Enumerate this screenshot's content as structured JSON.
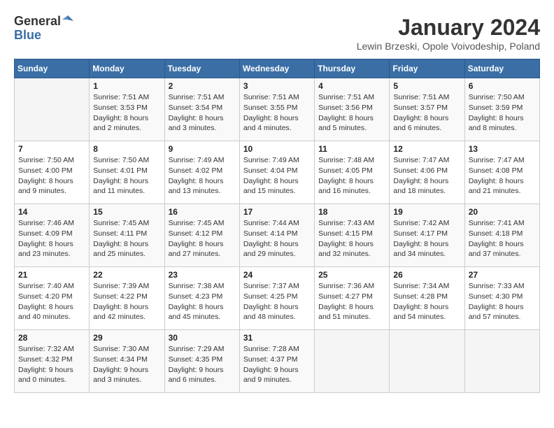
{
  "logo": {
    "general": "General",
    "blue": "Blue"
  },
  "title": "January 2024",
  "subtitle": "Lewin Brzeski, Opole Voivodeship, Poland",
  "days_of_week": [
    "Sunday",
    "Monday",
    "Tuesday",
    "Wednesday",
    "Thursday",
    "Friday",
    "Saturday"
  ],
  "weeks": [
    [
      {
        "day": "",
        "info": ""
      },
      {
        "day": "1",
        "info": "Sunrise: 7:51 AM\nSunset: 3:53 PM\nDaylight: 8 hours\nand 2 minutes."
      },
      {
        "day": "2",
        "info": "Sunrise: 7:51 AM\nSunset: 3:54 PM\nDaylight: 8 hours\nand 3 minutes."
      },
      {
        "day": "3",
        "info": "Sunrise: 7:51 AM\nSunset: 3:55 PM\nDaylight: 8 hours\nand 4 minutes."
      },
      {
        "day": "4",
        "info": "Sunrise: 7:51 AM\nSunset: 3:56 PM\nDaylight: 8 hours\nand 5 minutes."
      },
      {
        "day": "5",
        "info": "Sunrise: 7:51 AM\nSunset: 3:57 PM\nDaylight: 8 hours\nand 6 minutes."
      },
      {
        "day": "6",
        "info": "Sunrise: 7:50 AM\nSunset: 3:59 PM\nDaylight: 8 hours\nand 8 minutes."
      }
    ],
    [
      {
        "day": "7",
        "info": "Sunrise: 7:50 AM\nSunset: 4:00 PM\nDaylight: 8 hours\nand 9 minutes."
      },
      {
        "day": "8",
        "info": "Sunrise: 7:50 AM\nSunset: 4:01 PM\nDaylight: 8 hours\nand 11 minutes."
      },
      {
        "day": "9",
        "info": "Sunrise: 7:49 AM\nSunset: 4:02 PM\nDaylight: 8 hours\nand 13 minutes."
      },
      {
        "day": "10",
        "info": "Sunrise: 7:49 AM\nSunset: 4:04 PM\nDaylight: 8 hours\nand 15 minutes."
      },
      {
        "day": "11",
        "info": "Sunrise: 7:48 AM\nSunset: 4:05 PM\nDaylight: 8 hours\nand 16 minutes."
      },
      {
        "day": "12",
        "info": "Sunrise: 7:47 AM\nSunset: 4:06 PM\nDaylight: 8 hours\nand 18 minutes."
      },
      {
        "day": "13",
        "info": "Sunrise: 7:47 AM\nSunset: 4:08 PM\nDaylight: 8 hours\nand 21 minutes."
      }
    ],
    [
      {
        "day": "14",
        "info": "Sunrise: 7:46 AM\nSunset: 4:09 PM\nDaylight: 8 hours\nand 23 minutes."
      },
      {
        "day": "15",
        "info": "Sunrise: 7:45 AM\nSunset: 4:11 PM\nDaylight: 8 hours\nand 25 minutes."
      },
      {
        "day": "16",
        "info": "Sunrise: 7:45 AM\nSunset: 4:12 PM\nDaylight: 8 hours\nand 27 minutes."
      },
      {
        "day": "17",
        "info": "Sunrise: 7:44 AM\nSunset: 4:14 PM\nDaylight: 8 hours\nand 29 minutes."
      },
      {
        "day": "18",
        "info": "Sunrise: 7:43 AM\nSunset: 4:15 PM\nDaylight: 8 hours\nand 32 minutes."
      },
      {
        "day": "19",
        "info": "Sunrise: 7:42 AM\nSunset: 4:17 PM\nDaylight: 8 hours\nand 34 minutes."
      },
      {
        "day": "20",
        "info": "Sunrise: 7:41 AM\nSunset: 4:18 PM\nDaylight: 8 hours\nand 37 minutes."
      }
    ],
    [
      {
        "day": "21",
        "info": "Sunrise: 7:40 AM\nSunset: 4:20 PM\nDaylight: 8 hours\nand 40 minutes."
      },
      {
        "day": "22",
        "info": "Sunrise: 7:39 AM\nSunset: 4:22 PM\nDaylight: 8 hours\nand 42 minutes."
      },
      {
        "day": "23",
        "info": "Sunrise: 7:38 AM\nSunset: 4:23 PM\nDaylight: 8 hours\nand 45 minutes."
      },
      {
        "day": "24",
        "info": "Sunrise: 7:37 AM\nSunset: 4:25 PM\nDaylight: 8 hours\nand 48 minutes."
      },
      {
        "day": "25",
        "info": "Sunrise: 7:36 AM\nSunset: 4:27 PM\nDaylight: 8 hours\nand 51 minutes."
      },
      {
        "day": "26",
        "info": "Sunrise: 7:34 AM\nSunset: 4:28 PM\nDaylight: 8 hours\nand 54 minutes."
      },
      {
        "day": "27",
        "info": "Sunrise: 7:33 AM\nSunset: 4:30 PM\nDaylight: 8 hours\nand 57 minutes."
      }
    ],
    [
      {
        "day": "28",
        "info": "Sunrise: 7:32 AM\nSunset: 4:32 PM\nDaylight: 9 hours\nand 0 minutes."
      },
      {
        "day": "29",
        "info": "Sunrise: 7:30 AM\nSunset: 4:34 PM\nDaylight: 9 hours\nand 3 minutes."
      },
      {
        "day": "30",
        "info": "Sunrise: 7:29 AM\nSunset: 4:35 PM\nDaylight: 9 hours\nand 6 minutes."
      },
      {
        "day": "31",
        "info": "Sunrise: 7:28 AM\nSunset: 4:37 PM\nDaylight: 9 hours\nand 9 minutes."
      },
      {
        "day": "",
        "info": ""
      },
      {
        "day": "",
        "info": ""
      },
      {
        "day": "",
        "info": ""
      }
    ]
  ]
}
